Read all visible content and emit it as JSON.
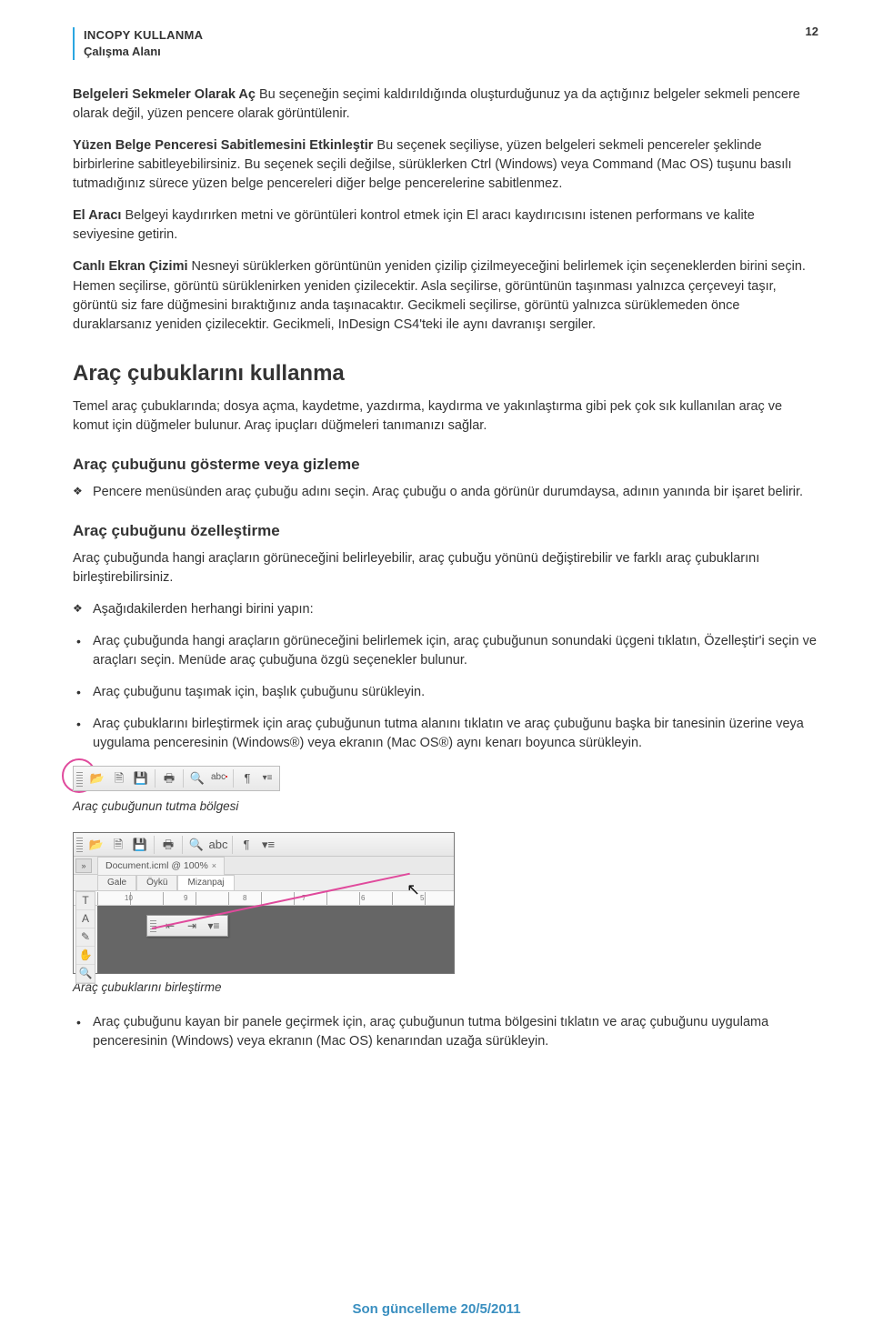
{
  "header": {
    "title": "INCOPY KULLANMA",
    "sub": "Çalışma Alanı"
  },
  "page_num": "12",
  "paras": {
    "p1_lead": "Belgeleri Sekmeler Olarak Aç",
    "p1": "  Bu seçeneğin seçimi kaldırıldığında oluşturduğunuz ya da açtığınız belgeler sekmeli pencere olarak değil, yüzen pencere olarak görüntülenir.",
    "p2_lead": "Yüzen Belge Penceresi Sabitlemesini Etkinleştir",
    "p2": "  Bu seçenek seçiliyse, yüzen belgeleri sekmeli pencereler şeklinde birbirlerine sabitleyebilirsiniz. Bu seçenek seçili değilse, sürüklerken Ctrl (Windows) veya Command (Mac OS) tuşunu basılı tutmadığınız sürece yüzen belge pencereleri diğer belge pencerelerine sabitlenmez.",
    "p3_lead": "El Aracı",
    "p3": "  Belgeyi kaydırırken metni ve görüntüleri kontrol etmek için El aracı kaydırıcısını istenen performans ve kalite seviyesine getirin.",
    "p4_lead": "Canlı Ekran Çizimi",
    "p4": "  Nesneyi sürüklerken görüntünün yeniden çizilip çizilmeyeceğini belirlemek için seçeneklerden birini seçin. Hemen seçilirse, görüntü sürüklenirken yeniden çizilecektir. Asla seçilirse, görüntünün taşınması yalnızca çerçeveyi taşır, görüntü siz fare düğmesini bıraktığınız anda taşınacaktır. Gecikmeli seçilirse, görüntü yalnızca sürüklemeden önce duraklarsanız yeniden çizilecektir. Gecikmeli, InDesign CS4'teki ile aynı davranışı sergiler."
  },
  "h2_1": "Araç çubuklarını kullanma",
  "after_h2_1": "Temel araç çubuklarında; dosya açma, kaydetme, yazdırma, kaydırma ve yakınlaştırma gibi pek çok sık kullanılan araç ve komut için düğmeler bulunur. Araç ipuçları düğmeleri tanımanızı sağlar.",
  "h3_1": "Araç çubuğunu gösterme veya gizleme",
  "d1": "Pencere menüsünden araç çubuğu adını seçin. Araç çubuğu o anda görünür durumdaysa, adının yanında bir işaret belirir.",
  "h3_2": "Araç çubuğunu özelleştirme",
  "after_h3_2": "Araç çubuğunda hangi araçların görüneceğini belirleyebilir, araç çubuğu yönünü değiştirebilir ve farklı araç çubuklarını birleştirebilirsiniz.",
  "d2": "Aşağıdakilerden herhangi birini yapın:",
  "b1": "Araç çubuğunda hangi araçların görüneceğini belirlemek için, araç çubuğunun sonundaki üçgeni tıklatın, Özelleştir'i seçin ve araçları seçin. Menüde araç çubuğuna özgü seçenekler bulunur.",
  "b2": "Araç çubuğunu taşımak için, başlık çubuğunu sürükleyin.",
  "b3": "Araç çubuklarını birleştirmek için araç çubuğunun tutma alanını tıklatın ve araç çubuğunu başka bir tanesinin üzerine veya uygulama penceresinin (Windows®) veya ekranın (Mac OS®) aynı kenarı boyunca sürükleyin.",
  "fig1_caption": "Araç çubuğunun tutma bölgesi",
  "fig2": {
    "doc_tab": "Document.icml @ 100%",
    "view_tabs": [
      "Gale",
      "Öykü",
      "Mizanpaj"
    ],
    "ruler_marks": [
      "10",
      "9",
      "8",
      "7",
      "6",
      "5"
    ]
  },
  "fig2_caption": "Araç çubuklarını birleştirme",
  "b4": "Araç çubuğunu kayan bir panele geçirmek için, araç çubuğunun tutma bölgesini tıklatın ve araç çubuğunu uygulama penceresinin (Windows) veya ekranın (Mac OS) kenarından uzağa sürükleyin.",
  "footer": "Son güncelleme 20/5/2011",
  "icons": {
    "open": "📂",
    "new": "🗎",
    "save": "💾",
    "print": "🖶",
    "find": "🔍",
    "abc": "abc",
    "para": "¶",
    "menu": "▾≡",
    "typeT": "T",
    "noteA": "A",
    "eyedrop": "✎",
    "hand": "✋",
    "zoom": "🔍",
    "goL": "⇤",
    "goR": "⇥"
  }
}
